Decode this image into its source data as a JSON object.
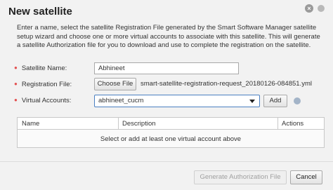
{
  "dialog": {
    "title": "New satellite",
    "close_glyph": "×",
    "description_lines": [
      "Enter a name, select the satellite Registration File generated by the Smart Software Manager satellite",
      "setup wizard and choose one or more virtual accounts to associate with this satellite. This will generate",
      "a satellite Authorization file for you to download and use to complete the registration on the satellite."
    ]
  },
  "form": {
    "required_marker": "●",
    "satellite_name": {
      "label": "Satellite Name:",
      "value": "Abhineet"
    },
    "registration_file": {
      "label": "Registration File:",
      "button_label": "Choose File",
      "file_name": "smart-satellite-registration-request_20180126-084851.yml"
    },
    "virtual_accounts": {
      "label": "Virtual Accounts:",
      "selected": "abhineet_cucm",
      "add_label": "Add"
    }
  },
  "table": {
    "columns": [
      "Name",
      "Description",
      "Actions"
    ],
    "empty_message": "Select or add at least one virtual account above"
  },
  "footer": {
    "generate_label": "Generate Authorization File",
    "cancel_label": "Cancel"
  },
  "colors": {
    "required": "#e35050",
    "select_border": "#4a7fc1",
    "disabled_text": "#a0a0a0"
  },
  "icons": {
    "close": "close-icon",
    "help": "help-icon",
    "dropdown": "chevron-down-icon"
  }
}
